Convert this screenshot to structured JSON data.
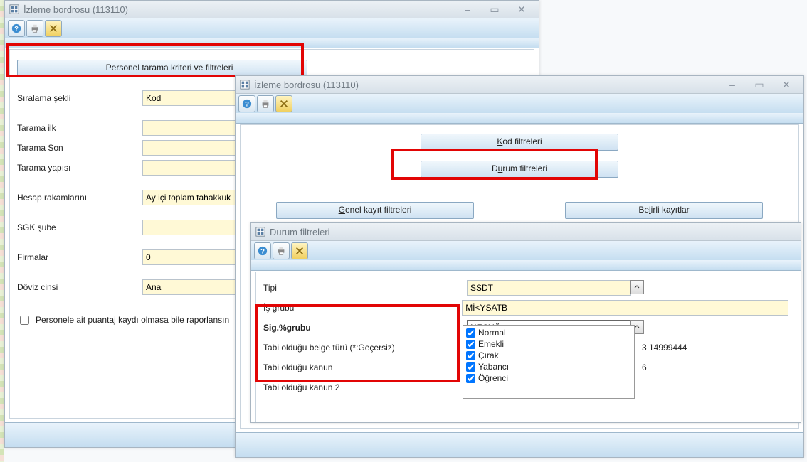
{
  "win1": {
    "title": "İzleme bordrosu (113110)",
    "buttons": {
      "personel_kriter": "Personel tarama kriteri ve filtreleri"
    },
    "labels": {
      "siralama": "Sıralama şekli",
      "tarama_ilk": "Tarama ilk",
      "tarama_son": "Tarama Son",
      "tarama_yapisi": "Tarama yapısı",
      "hesap_rakam": "Hesap rakamlarını",
      "sgk_sube": "SGK şube",
      "firmalar": "Firmalar",
      "doviz": "Döviz cinsi",
      "puantaj_chk": "Personele ait puantaj kaydı olmasa bile raporlansın"
    },
    "values": {
      "siralama": "Kod",
      "hesap_rakam": "Ay içi toplam tahakkuk",
      "firmalar": "0",
      "doviz": "Ana"
    }
  },
  "win2": {
    "title": "İzleme bordrosu (113110)",
    "buttons": {
      "kod": "Kod filtreleri",
      "durum": "Durum filtreleri",
      "genel": "Genel kayıt filtreleri",
      "belirli": "Belirli kayıtlar"
    }
  },
  "win3": {
    "title": "Durum filtreleri",
    "labels": {
      "tipi": "Tipi",
      "is_grubu": "İş grubu",
      "sig_grubu": "Sig.%grubu",
      "tabi_belge": "Tabi olduğu belge türü (*:Geçersiz)",
      "tabi_kanun": "Tabi olduğu kanun",
      "tabi_kanun2": "Tabi olduğu kanun 2"
    },
    "values": {
      "tipi": "SSDT",
      "is_grubu": "Mİ<YSATB",
      "sig_grubu": "NEÇYÖ",
      "tabi_belge_partial_a": "3 14999444",
      "tabi_belge_partial_b": "6"
    },
    "options": [
      "Normal",
      "Emekli",
      "Çırak",
      "Yabancı",
      "Öğrenci"
    ]
  }
}
